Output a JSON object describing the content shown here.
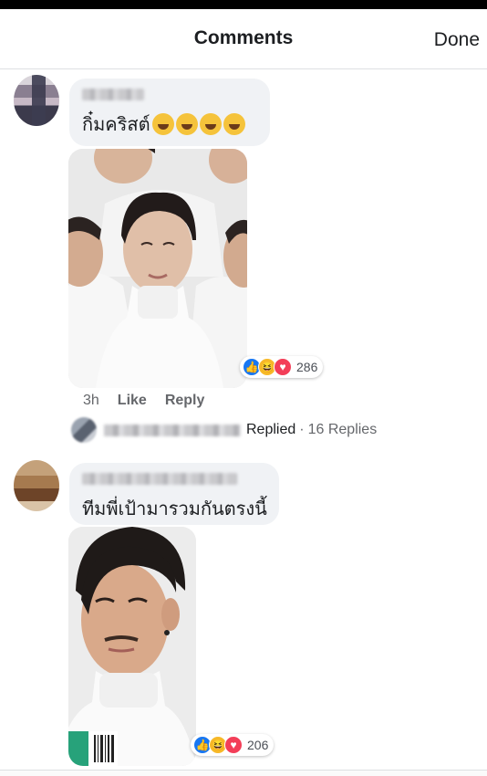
{
  "header": {
    "title": "Comments",
    "done_label": "Done"
  },
  "comments": [
    {
      "text": "กิ๋มคริสต์",
      "emoji": [
        "face-with-tears-of-joy",
        "face-with-tears-of-joy",
        "face-with-tears-of-joy",
        "face-with-tears-of-joy"
      ],
      "reactions": {
        "types": [
          "like",
          "haha",
          "love"
        ],
        "count": "286"
      },
      "time": "3h",
      "like_label": "Like",
      "reply_label": "Reply",
      "replies": {
        "replied_label": "Replied",
        "separator": "·",
        "count_label": "16 Replies"
      }
    },
    {
      "text": "ทีมพี่เป้ามารวมกันตรงนี้",
      "reactions": {
        "types": [
          "like",
          "haha",
          "love"
        ],
        "count": "206"
      }
    }
  ],
  "colors": {
    "like": "#1877f2",
    "haha": "#f7b928",
    "love": "#f33e58",
    "bubble": "#f0f2f5"
  }
}
